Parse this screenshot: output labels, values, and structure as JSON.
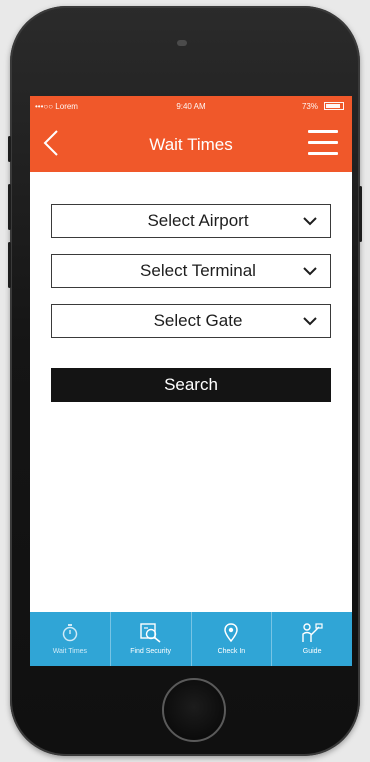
{
  "status_bar": {
    "carrier": "•••○○ Lorem",
    "time": "9:40 AM",
    "battery": "73%"
  },
  "header": {
    "title": "Wait Times"
  },
  "form": {
    "airport": "Select Airport",
    "terminal": "Select Terminal",
    "gate": "Select Gate",
    "search_label": "Search"
  },
  "tabs": [
    {
      "label": "Wait Times",
      "icon": "stopwatch-icon"
    },
    {
      "label": "Find Security",
      "icon": "security-search-icon"
    },
    {
      "label": "Check In",
      "icon": "location-pin-icon"
    },
    {
      "label": "Guide",
      "icon": "guide-person-icon"
    }
  ],
  "colors": {
    "header": "#f0582a",
    "tabbar": "#30a5d6",
    "search_button": "#141414"
  }
}
